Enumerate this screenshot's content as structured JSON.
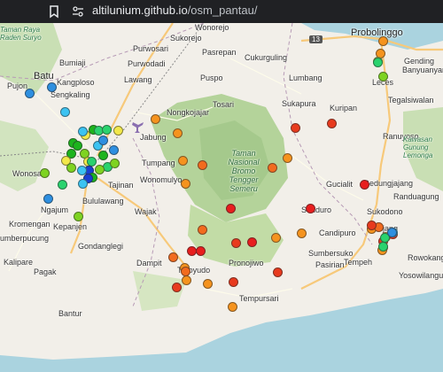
{
  "browser": {
    "host": "altilunium.github.io",
    "path": "/osm_pantau/",
    "bookmark_icon": "bookmark-icon",
    "site_info_icon": "site-info-icon"
  },
  "map": {
    "highway_shield": "13",
    "places": [
      {
        "id": "taman-raya-raden-suryo",
        "text": "Taman Raya Raden Suryo",
        "cls": "green"
      },
      {
        "id": "pujon",
        "text": "Pujon"
      },
      {
        "id": "batu",
        "text": "Batu",
        "cls": "big"
      },
      {
        "id": "bumiaji",
        "text": "Bumiaji"
      },
      {
        "id": "kangploso",
        "text": "Kangploso"
      },
      {
        "id": "sengkaling",
        "text": "Sengkaling"
      },
      {
        "id": "wonosari",
        "text": "Wonosari"
      },
      {
        "id": "ngajum",
        "text": "Ngajum"
      },
      {
        "id": "kepanjen",
        "text": "Kepanjen"
      },
      {
        "id": "kromengan",
        "text": "Kromengan"
      },
      {
        "id": "sumberpucung",
        "text": "umberpucung"
      },
      {
        "id": "kalipare",
        "text": "Kalipare"
      },
      {
        "id": "pagak",
        "text": "Pagak"
      },
      {
        "id": "bantur",
        "text": "Bantur"
      },
      {
        "id": "gondanglegi",
        "text": "Gondanglegi"
      },
      {
        "id": "bululawang",
        "text": "Bululawang"
      },
      {
        "id": "tajinan",
        "text": "Tajinan"
      },
      {
        "id": "wajak",
        "text": "Wajak"
      },
      {
        "id": "wonomulyo",
        "text": "Wonomulyo"
      },
      {
        "id": "tumpang",
        "text": "Tumpang"
      },
      {
        "id": "jabung",
        "text": "Jabung"
      },
      {
        "id": "nongkojajar",
        "text": "Nongkojajar"
      },
      {
        "id": "lawang",
        "text": "Lawang"
      },
      {
        "id": "purwodadi",
        "text": "Purwodadi"
      },
      {
        "id": "purwosari",
        "text": "Purwosari"
      },
      {
        "id": "sukorejo",
        "text": "Sukorejo"
      },
      {
        "id": "wonorejo",
        "text": "Wonorejo"
      },
      {
        "id": "pasrepan",
        "text": "Pasrepan"
      },
      {
        "id": "puspo",
        "text": "Puspo"
      },
      {
        "id": "tosari",
        "text": "Tosari"
      },
      {
        "id": "cukurguling",
        "text": "Cukurguling"
      },
      {
        "id": "lumbang",
        "text": "Lumbang"
      },
      {
        "id": "sukapura",
        "text": "Sukapura"
      },
      {
        "id": "kuripan",
        "text": "Kuripan"
      },
      {
        "id": "probolinggo",
        "text": "Probolinggo",
        "cls": "big"
      },
      {
        "id": "gending",
        "text": "Gending"
      },
      {
        "id": "leces",
        "text": "Leces"
      },
      {
        "id": "tegalsiwalan",
        "text": "Tegalsiwalan"
      },
      {
        "id": "banyuanyar",
        "text": "Banyuanyar"
      },
      {
        "id": "ranuyoso",
        "text": "Ranuyoso"
      },
      {
        "id": "gucialit",
        "text": "Gucialit"
      },
      {
        "id": "gedungjajang",
        "text": "Gedungjajang"
      },
      {
        "id": "randuagung",
        "text": "Randuagung"
      },
      {
        "id": "sukodono",
        "text": "Sukodono"
      },
      {
        "id": "lumajang",
        "text": "ijang"
      },
      {
        "id": "senduro",
        "text": "Senduro"
      },
      {
        "id": "sumbersuko",
        "text": "Sumbersuko"
      },
      {
        "id": "pasirian",
        "text": "Pasirian"
      },
      {
        "id": "tempeh",
        "text": "Tempeh"
      },
      {
        "id": "rowokangkung",
        "text": "Rowokangk"
      },
      {
        "id": "yosowilangun",
        "text": "Yosowilangun"
      },
      {
        "id": "candipuro",
        "text": "Candipuro"
      },
      {
        "id": "pronojiwo",
        "text": "Pronojiwo"
      },
      {
        "id": "tempursari",
        "text": "Tempursari"
      },
      {
        "id": "dampit",
        "text": "Dampit"
      },
      {
        "id": "tirtoyudo",
        "text": "Tirtoyudo"
      },
      {
        "id": "kawasan-gunung-lemongan",
        "text": "Kawasan Gunung Lemonga",
        "cls": "green"
      },
      {
        "id": "bromo-tengger-semeru",
        "text": "Taman Nasional Bromo Tengger Semeru",
        "cls": "park"
      }
    ],
    "markers": [
      {
        "color": "#2e8fe0"
      },
      {
        "color": "#2e8fe0"
      },
      {
        "color": "#3cc3f2"
      },
      {
        "color": "#f2e84a"
      },
      {
        "color": "#1db41d"
      },
      {
        "color": "#3cc3f2"
      },
      {
        "color": "#1db41d"
      },
      {
        "color": "#2ad36e"
      },
      {
        "color": "#2ad36e"
      },
      {
        "color": "#3cc3f2"
      },
      {
        "color": "#1db41d"
      },
      {
        "color": "#2e8fe0"
      },
      {
        "color": "#1db41d"
      },
      {
        "color": "#7ed321"
      },
      {
        "color": "#f2e84a"
      },
      {
        "color": "#f2e84a"
      },
      {
        "color": "#1db41d"
      },
      {
        "color": "#2ad36e"
      },
      {
        "color": "#1a3fd0"
      },
      {
        "color": "#3cc3f2"
      },
      {
        "color": "#7ed321"
      },
      {
        "color": "#2ad36e"
      },
      {
        "color": "#7ed321"
      },
      {
        "color": "#1db41d"
      },
      {
        "color": "#f2e84a"
      },
      {
        "color": "#2e8fe0"
      },
      {
        "color": "#7ed321"
      },
      {
        "color": "#7ed321"
      },
      {
        "color": "#2ad36e"
      },
      {
        "color": "#2e8fe0"
      },
      {
        "color": "#1a3fd0"
      },
      {
        "color": "#7ed321"
      },
      {
        "color": "#3cc3f2"
      },
      {
        "color": "#f5931e"
      },
      {
        "color": "#f5931e"
      },
      {
        "color": "#f5931e"
      },
      {
        "color": "#f5931e"
      },
      {
        "color": "#f26b1e"
      },
      {
        "color": "#e83a1e"
      },
      {
        "color": "#e83a1e"
      },
      {
        "color": "#f5931e"
      },
      {
        "color": "#f5931e"
      },
      {
        "color": "#f26b1e"
      },
      {
        "color": "#f5931e"
      },
      {
        "color": "#e81e1e"
      },
      {
        "color": "#e81e1e"
      },
      {
        "color": "#e81e1e"
      },
      {
        "color": "#e83a1e"
      },
      {
        "color": "#e81e1e"
      },
      {
        "color": "#f5931e"
      },
      {
        "color": "#f5931e"
      },
      {
        "color": "#f26b1e"
      },
      {
        "color": "#f26b1e"
      },
      {
        "color": "#f5931e"
      },
      {
        "color": "#e81e1e"
      },
      {
        "color": "#f5931e"
      },
      {
        "color": "#e81e1e"
      },
      {
        "color": "#e83a1e"
      },
      {
        "color": "#f5931e"
      },
      {
        "color": "#e83a1e"
      },
      {
        "color": "#f26b1e"
      },
      {
        "color": "#f5931e"
      },
      {
        "color": "#e83a1e"
      },
      {
        "color": "#f5931e"
      },
      {
        "color": "#f26b1e"
      },
      {
        "color": "#f5931e"
      },
      {
        "color": "#e83a1e"
      },
      {
        "color": "#e83a1e"
      },
      {
        "color": "#f5931e"
      },
      {
        "color": "#f2e84a"
      },
      {
        "color": "#7ed321"
      },
      {
        "color": "#f5931e"
      },
      {
        "color": "#3cc3f2"
      },
      {
        "color": "#e83a1e"
      },
      {
        "color": "#2ad36e"
      },
      {
        "color": "#2ad36e"
      },
      {
        "color": "#2e8fe0"
      },
      {
        "color": "#2ad36e"
      }
    ]
  }
}
